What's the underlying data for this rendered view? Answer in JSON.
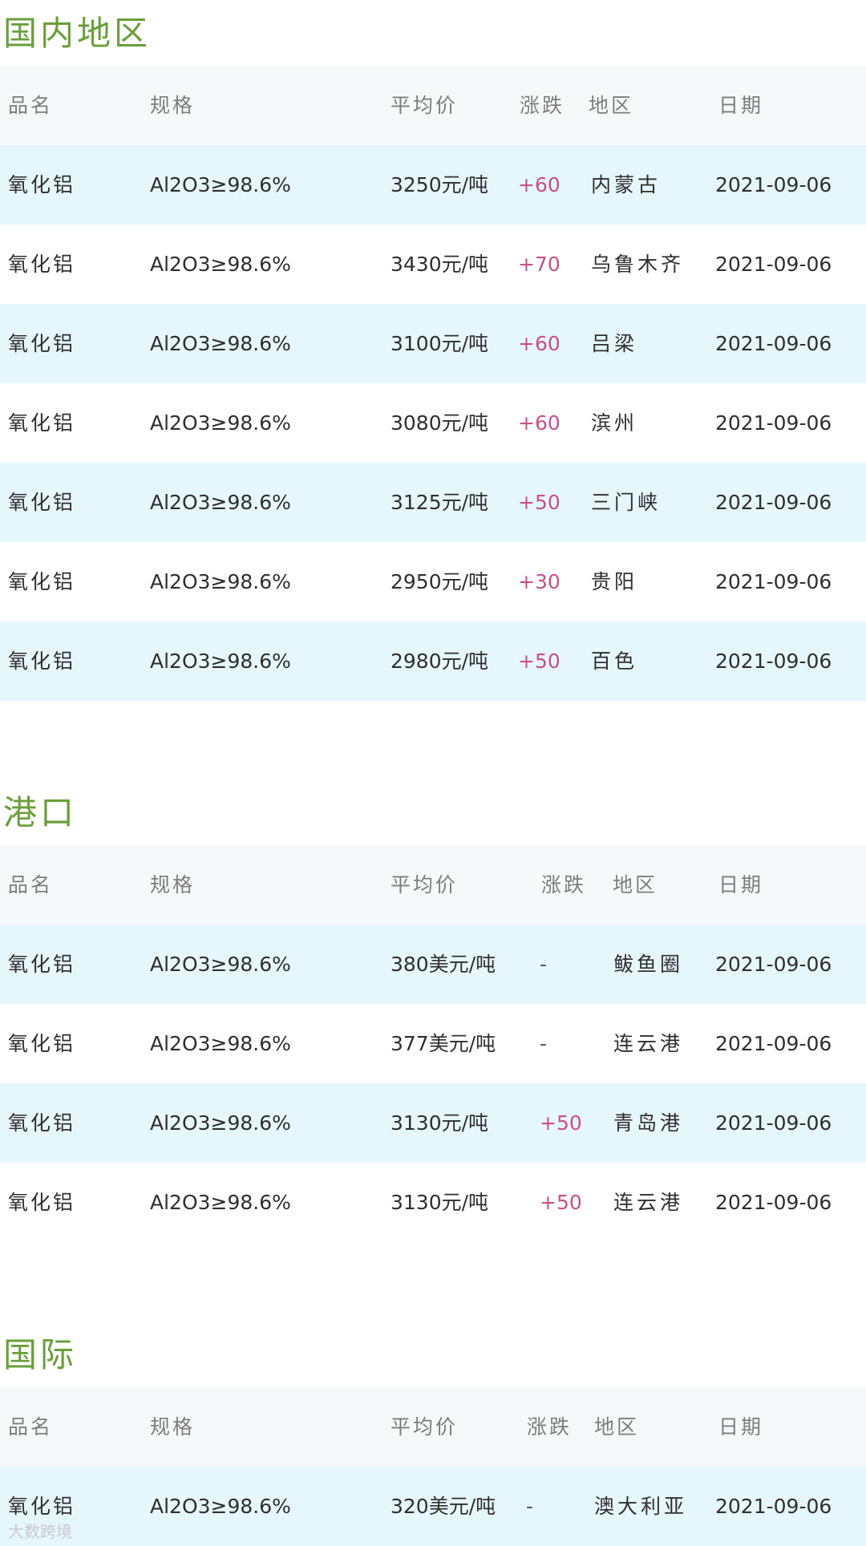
{
  "sections": [
    {
      "title": "国内地区",
      "headers": {
        "name": "品名",
        "spec": "规格",
        "price": "平均价",
        "change": "涨跌",
        "region": "地区",
        "date": "日期"
      },
      "rows": [
        {
          "name": "氧化铝",
          "spec": "Al2O3≥98.6%",
          "price": "3250元/吨",
          "change": "+60",
          "region": "内蒙古",
          "date": "2021-09-06"
        },
        {
          "name": "氧化铝",
          "spec": "Al2O3≥98.6%",
          "price": "3430元/吨",
          "change": "+70",
          "region": "乌鲁木齐",
          "date": "2021-09-06"
        },
        {
          "name": "氧化铝",
          "spec": "Al2O3≥98.6%",
          "price": "3100元/吨",
          "change": "+60",
          "region": "吕梁",
          "date": "2021-09-06"
        },
        {
          "name": "氧化铝",
          "spec": "Al2O3≥98.6%",
          "price": "3080元/吨",
          "change": "+60",
          "region": "滨州",
          "date": "2021-09-06"
        },
        {
          "name": "氧化铝",
          "spec": "Al2O3≥98.6%",
          "price": "3125元/吨",
          "change": "+50",
          "region": "三门峡",
          "date": "2021-09-06"
        },
        {
          "name": "氧化铝",
          "spec": "Al2O3≥98.6%",
          "price": "2950元/吨",
          "change": "+30",
          "region": "贵阳",
          "date": "2021-09-06"
        },
        {
          "name": "氧化铝",
          "spec": "Al2O3≥98.6%",
          "price": "2980元/吨",
          "change": "+50",
          "region": "百色",
          "date": "2021-09-06"
        }
      ]
    },
    {
      "title": "港口",
      "headers": {
        "name": "品名",
        "spec": "规格",
        "price": "平均价",
        "change": "涨跌",
        "region": "地区",
        "date": "日期"
      },
      "rows": [
        {
          "name": "氧化铝",
          "spec": "Al2O3≥98.6%",
          "price": "380美元/吨",
          "change": "-",
          "region": "鲅鱼圈",
          "date": "2021-09-06"
        },
        {
          "name": "氧化铝",
          "spec": "Al2O3≥98.6%",
          "price": "377美元/吨",
          "change": "-",
          "region": "连云港",
          "date": "2021-09-06"
        },
        {
          "name": "氧化铝",
          "spec": "Al2O3≥98.6%",
          "price": "3130元/吨",
          "change": "+50",
          "region": "青岛港",
          "date": "2021-09-06"
        },
        {
          "name": "氧化铝",
          "spec": "Al2O3≥98.6%",
          "price": "3130元/吨",
          "change": "+50",
          "region": "连云港",
          "date": "2021-09-06"
        }
      ]
    },
    {
      "title": "国际",
      "headers": {
        "name": "品名",
        "spec": "规格",
        "price": "平均价",
        "change": "涨跌",
        "region": "地区",
        "date": "日期"
      },
      "rows": [
        {
          "name": "氧化铝",
          "spec": "Al2O3≥98.6%",
          "price": "320美元/吨",
          "change": "-",
          "region": "澳大利亚",
          "date": "2021-09-06"
        }
      ]
    }
  ],
  "watermark": "大数跨境",
  "colors": {
    "title": "#6a9f3a",
    "change": "#c8508a",
    "row_highlight": "#e6f6fd",
    "header_bg": "#f7f8fa"
  }
}
